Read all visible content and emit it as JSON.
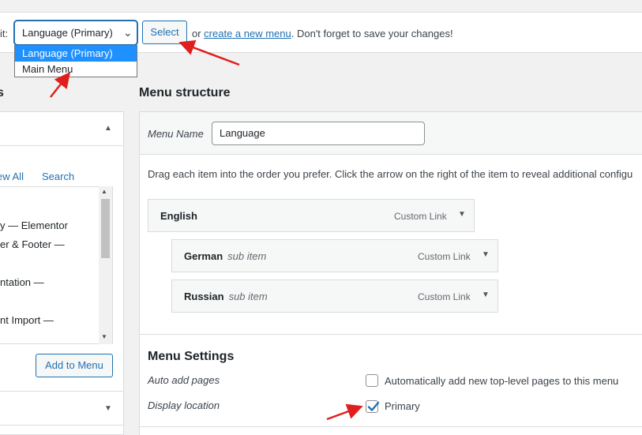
{
  "manage": {
    "edit_label": "it:",
    "select_value": "Language (Primary)",
    "select_button": "Select",
    "or_prefix": "or ",
    "create_link": "create a new menu",
    "or_suffix": ". Don't forget to save your changes!",
    "dropdown_options": [
      "Language (Primary)",
      "Main Menu"
    ]
  },
  "left": {
    "heading": "s",
    "view_all": "ew All",
    "search": "Search",
    "items": [
      "y — Elementor",
      "er & Footer —",
      "ntation —",
      "nt Import —"
    ],
    "add_button": "Add to Menu"
  },
  "menu": {
    "structure_heading": "Menu structure",
    "name_label": "Menu Name",
    "name_value": "Language",
    "drag_instructions": "Drag each item into the order you prefer. Click the arrow on the right of the item to reveal additional configu",
    "items": [
      {
        "title": "English",
        "sub": "",
        "type": "Custom Link"
      },
      {
        "title": "German",
        "sub": "sub item",
        "type": "Custom Link"
      },
      {
        "title": "Russian",
        "sub": "sub item",
        "type": "Custom Link"
      }
    ]
  },
  "settings": {
    "title": "Menu Settings",
    "auto_add_label": "Auto add pages",
    "auto_add_text": "Automatically add new top-level pages to this menu",
    "auto_add_checked": false,
    "display_label": "Display location",
    "primary_text": "Primary",
    "primary_checked": true
  },
  "colors": {
    "accent": "#2271b1",
    "dropdown_highlight": "#1e90ff",
    "annotation_arrow": "#e01e1e"
  }
}
